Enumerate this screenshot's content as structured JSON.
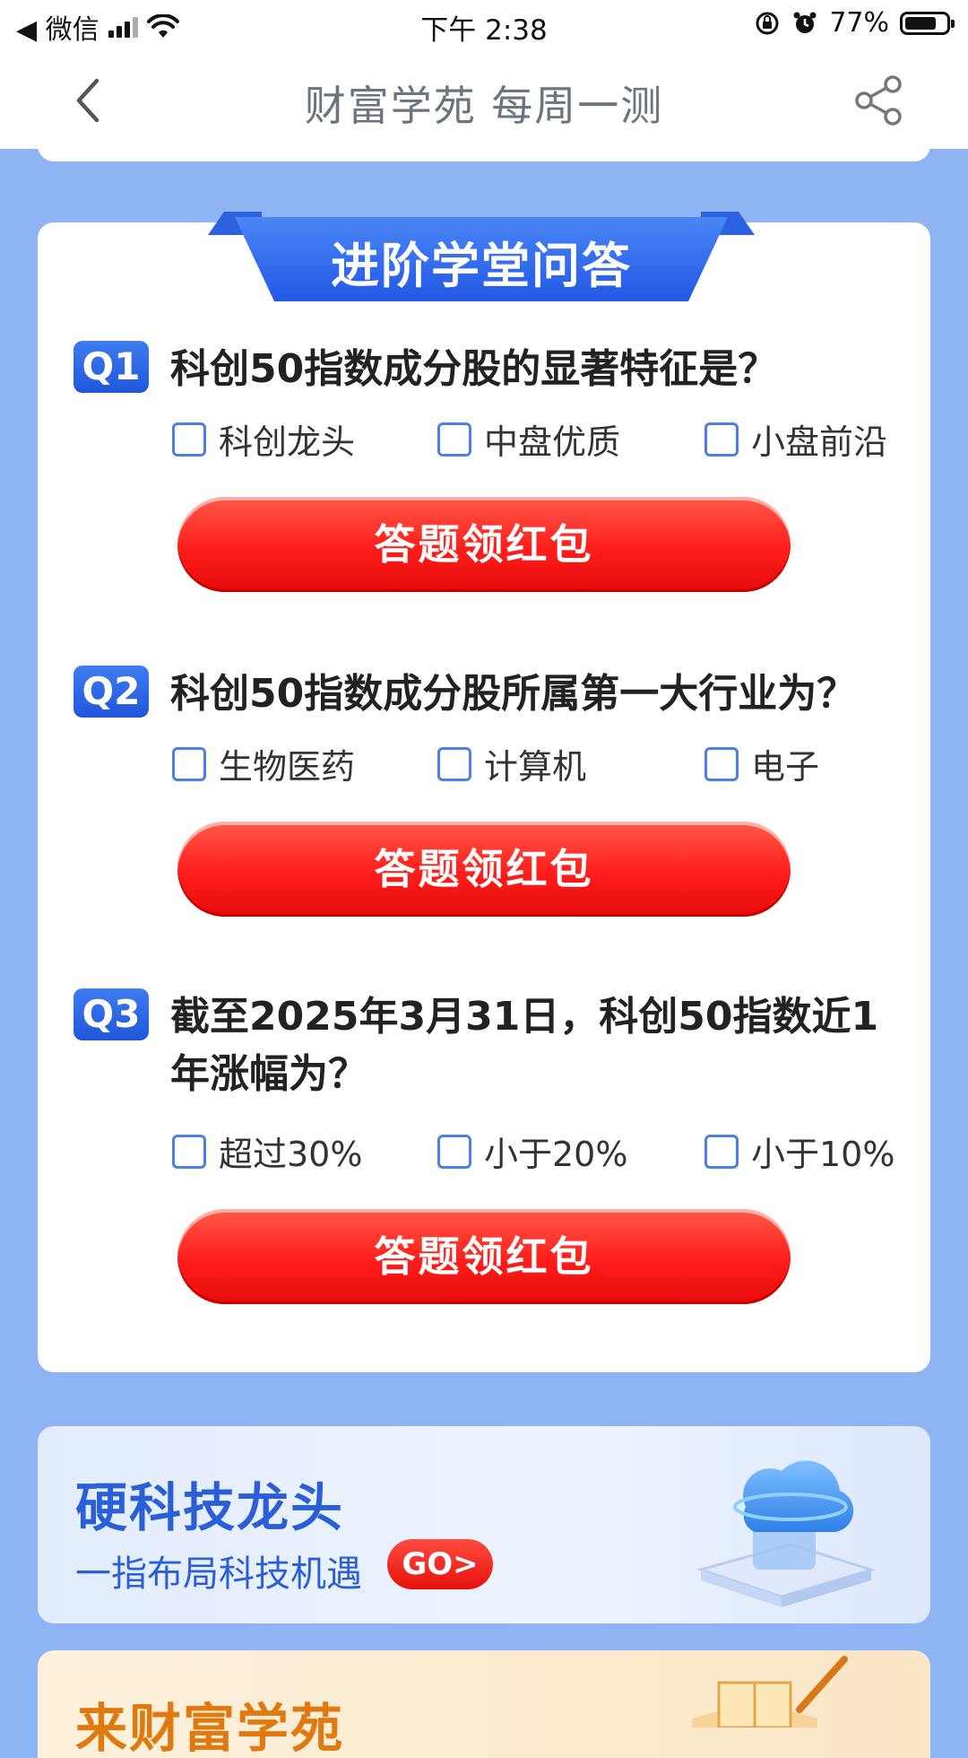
{
  "status_bar": {
    "carrier": "◀ 微信",
    "time": "下午 2:38",
    "battery": "77%",
    "battery_level": 0.77
  },
  "nav": {
    "title": "财富学苑 每周一测"
  },
  "quiz": {
    "banner": "进阶学堂问答",
    "questions": [
      {
        "num": "Q1",
        "text": "科创50指数成分股的显著特征是？",
        "options": [
          "科创龙头",
          "中盘优质",
          "小盘前沿"
        ],
        "button": "答题领红包"
      },
      {
        "num": "Q2",
        "text": "科创50指数成分股所属第一大行业为？",
        "options": [
          "生物医药",
          "计算机",
          "电子"
        ],
        "button": "答题领红包"
      },
      {
        "num": "Q3",
        "text": "截至2025年3月31日，科创50指数近1年涨幅为？",
        "options": [
          "超过30%",
          "小于20%",
          "小于10%"
        ],
        "button": "答题领红包"
      }
    ]
  },
  "promo1": {
    "heading": "硬科技龙头",
    "sub": "一指布局科技机遇",
    "go": "GO>"
  },
  "promo2": {
    "heading": "来财富学苑"
  },
  "colors": {
    "background": "#8fb4f4",
    "accent_blue": "#2b5fd8",
    "button_red": "#ff1d1a",
    "promo_orange": "#e07a10"
  }
}
